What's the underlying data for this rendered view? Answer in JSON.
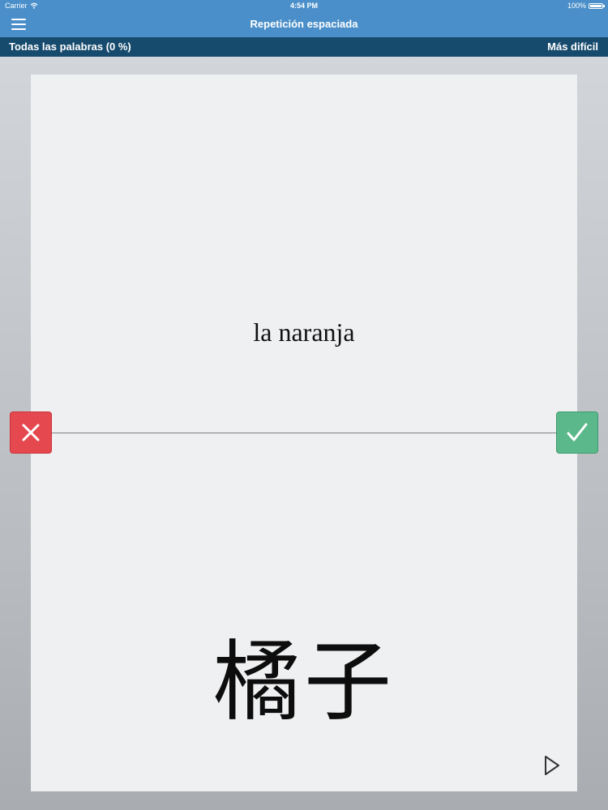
{
  "status_bar": {
    "carrier": "Carrier",
    "time": "4:54 PM",
    "battery": "100%"
  },
  "nav": {
    "title": "Repetición espaciada",
    "menu_icon": "hamburger-menu-icon"
  },
  "sub_bar": {
    "left_label": "Todas las palabras (0 %)",
    "right_label": "Más difícil"
  },
  "card": {
    "word": "la naranja",
    "answer": "橘子"
  },
  "icons": {
    "wrong": "x-icon",
    "right": "check-icon",
    "play": "play-icon"
  },
  "colors": {
    "header": "#4a8fc9",
    "sub_bar": "#174b6e",
    "wrong": "#e5484e",
    "right": "#5ab88b",
    "card": "#eef0f2"
  }
}
